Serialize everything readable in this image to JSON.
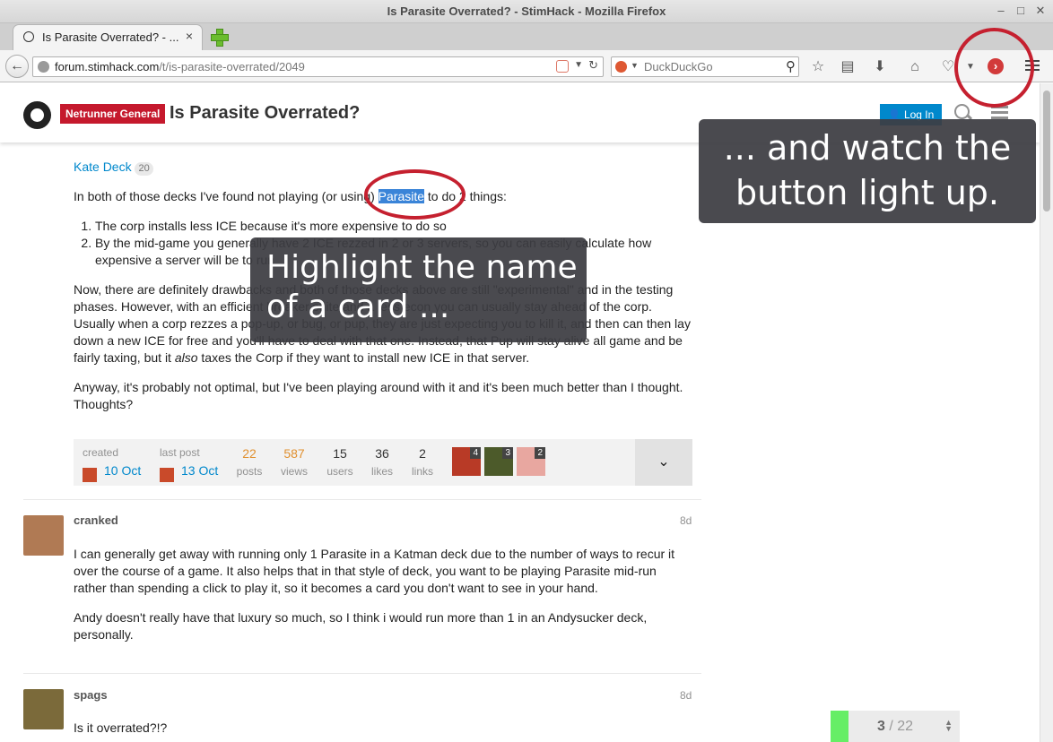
{
  "window": {
    "title": "Is Parasite Overrated? - StimHack - Mozilla Firefox",
    "min": "–",
    "max": "□",
    "close": "✕"
  },
  "tab": {
    "label": "Is Parasite Overrated? - ...",
    "close": "×"
  },
  "address": {
    "host": "forum.stimhack.com",
    "path": "/t/is-parasite-overrated/2049",
    "search_placeholder": "DuckDuckGo"
  },
  "toolbar_icons": [
    "star-icon",
    "reading-list-icon",
    "download-icon",
    "home-icon",
    "pocket-icon",
    "extension-icon",
    "menu-icon"
  ],
  "forum": {
    "category": "Netrunner General",
    "category_color": "#c5192d",
    "title": "Is Parasite Overrated?",
    "login": "Log In"
  },
  "post1": {
    "link_name": "Kate Deck",
    "link_count": "20",
    "intro_before": "In both of those decks I've found not playing (or using) ",
    "highlight": "Parasite",
    "intro_after": " to do 2 things:",
    "item1": "The corp installs less ICE because it's more expensive to do so",
    "item2": "By the mid-game you generally have 2 ICE rezzed in 2 or 3 servers, so you can easily calculate how expensive a server will be to run",
    "para2_a": "Now, there are definitely drawbacks and both of those decks above are still \"experimental\" and in the testing phases. However, with an efficient breaker suite and a less econ you can usually stay ahead of the corp. Usually when a corp rezzes a pop-up, or bug, or pup, they are just expecting you to kill it, and then can then lay down a new ICE for free and you'll have to deal with that one. Instead, that Pup will stay alive all game and be fairly taxing, but it ",
    "para2_em": "also",
    "para2_b": " taxes the Corp if they want to install new ICE in that server.",
    "para3": "Anyway, it's probably not optimal, but I've been playing around with it and it's been much better than I thought. Thoughts?"
  },
  "topic_map": {
    "created_label": "created",
    "created_date": "10 Oct",
    "last_post_label": "last post",
    "last_post_date": "13 Oct",
    "posts": "22",
    "posts_label": "posts",
    "views": "587",
    "views_label": "views",
    "users": "15",
    "users_label": "users",
    "likes": "36",
    "likes_label": "likes",
    "links": "2",
    "links_label": "links",
    "poster_counts": [
      "4",
      "3",
      "2"
    ],
    "expand": "⌄"
  },
  "post2": {
    "username": "cranked",
    "date": "8d",
    "p1": "I can generally get away with running only 1 Parasite in a Katman deck due to the number of ways to recur it over the course of a game. It also helps that in that style of deck, you want to be playing Parasite mid-run rather than spending a click to play it, so it becomes a card you don't want to see in your hand.",
    "p2": "Andy doesn't really have that luxury so much, so I think i would run more than 1 in an Andysucker deck, personally."
  },
  "post3": {
    "username": "spags",
    "date": "8d",
    "p1": "Is it overrated?!?"
  },
  "progress": {
    "current": "3",
    "separator": " / ",
    "total": "22",
    "fraction": 0.136,
    "fill_color": "#66ee66"
  },
  "callouts": {
    "right": [
      "... and watch the",
      "button light up."
    ],
    "left": [
      "Highlight the name",
      "of a card ..."
    ],
    "ring_color": "#c5202f"
  }
}
